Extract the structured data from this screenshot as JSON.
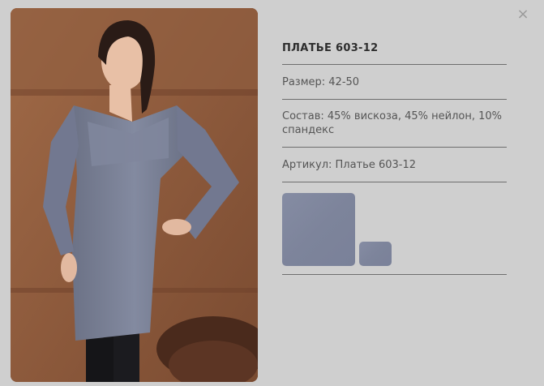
{
  "dialog": {
    "close_icon": "close-icon",
    "close_glyph": "×"
  },
  "product": {
    "title": "ПЛАТЬЕ 603-12",
    "size": "Размер: 42-50",
    "composition": "Состав: 45% вискоза, 45% нейлон, 10% спандекс",
    "article": "Артикул: Платье 603-12"
  },
  "swatches": [
    {
      "name": "gray-blue",
      "color": "#80879e"
    },
    {
      "name": "gray-blue",
      "color": "#80879e"
    }
  ],
  "colors": {
    "background": "#cfcfcf",
    "divider": "#6e6e6e",
    "swatch": "#80879e"
  }
}
